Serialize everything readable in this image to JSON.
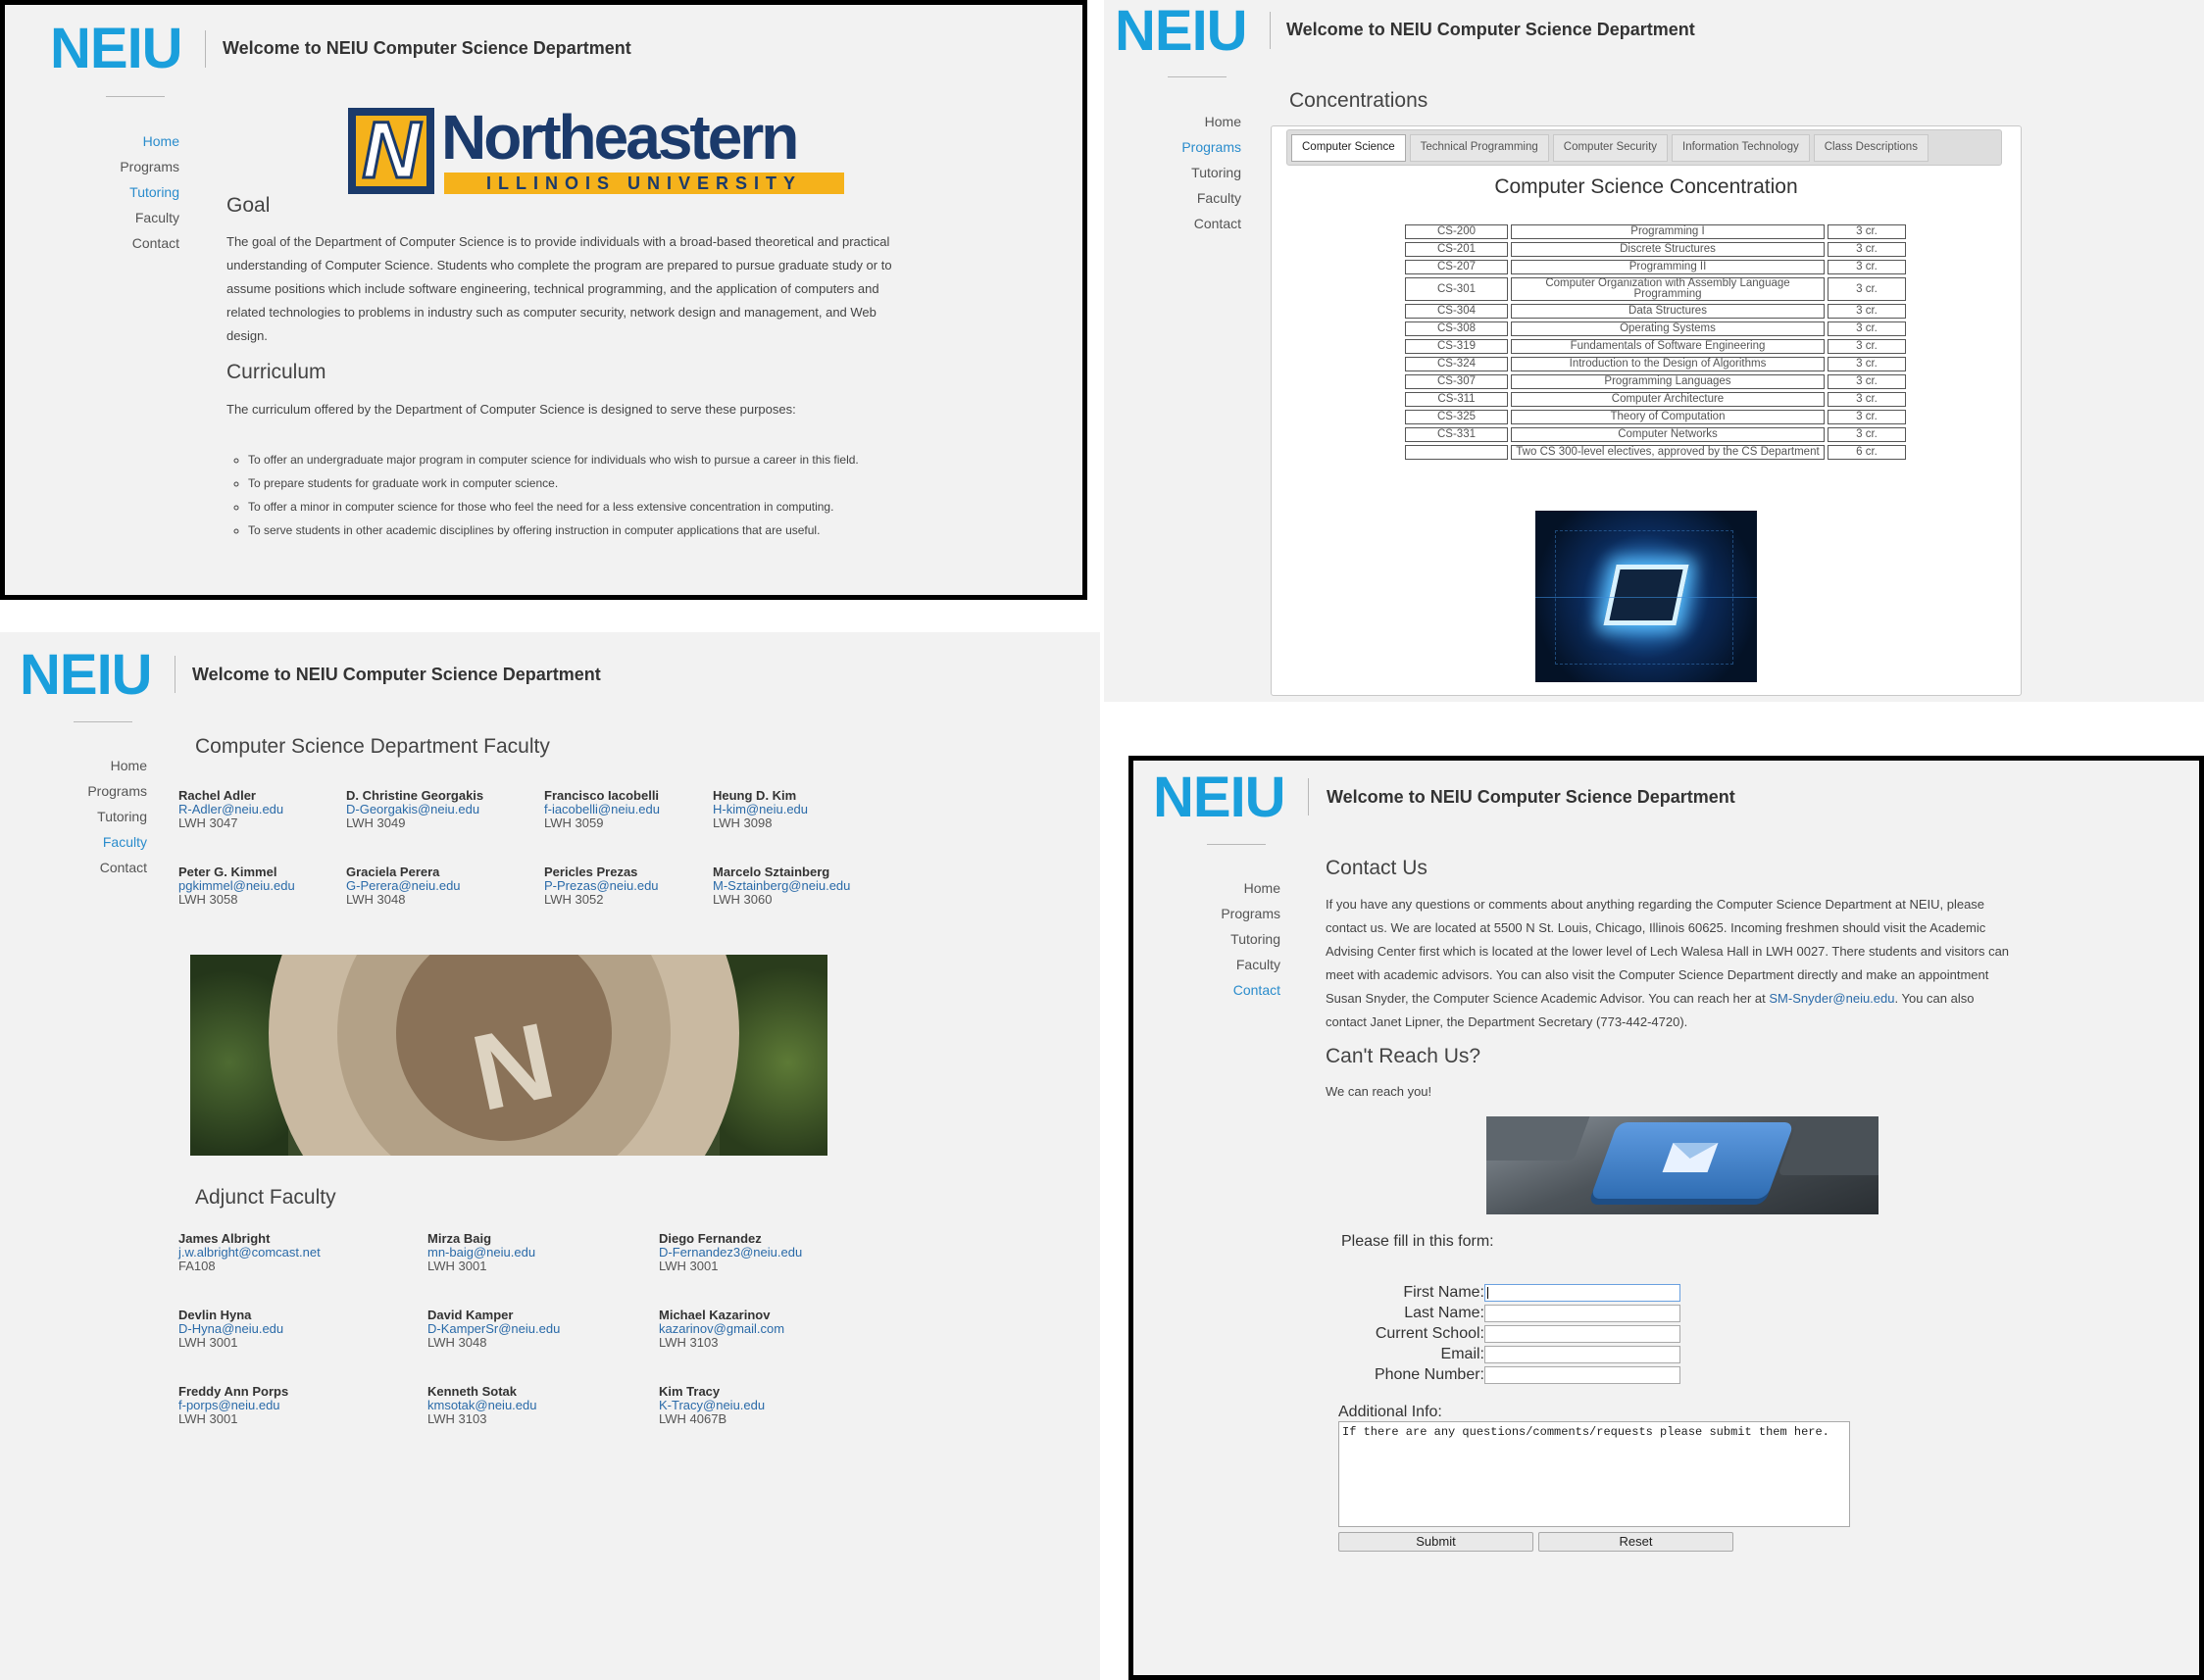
{
  "site": {
    "logo_text": "NEIU",
    "welcome": "Welcome to NEIU Computer Science Department",
    "nav": [
      "Home",
      "Programs",
      "Tutoring",
      "Faculty",
      "Contact"
    ]
  },
  "home": {
    "banner": {
      "word": "Northeastern",
      "sub": "ILLINOIS UNIVERSITY",
      "mark": "N"
    },
    "goal_title": "Goal",
    "goal_text": "The goal of the Department of Computer Science is to provide individuals with a broad-based theoretical and practical understanding of Computer Science. Students who complete the program are prepared to pursue graduate study or to assume positions which include software engineering, technical programming, and the application of computers and related technologies to problems in industry such as computer security, network design and management, and Web design.",
    "curriculum_title": "Curriculum",
    "curriculum_text": "The curriculum offered by the Department of Computer Science is designed to serve these purposes:",
    "purposes": [
      "To offer an undergraduate major program in computer science for individuals who wish to pursue a career in this field.",
      "To prepare students for graduate work in computer science.",
      "To offer a minor in computer science for those who feel the need for a less extensive concentration in computing.",
      "To serve students in other academic disciplines by offering instruction in computer applications that are useful."
    ]
  },
  "programs": {
    "title": "Concentrations",
    "tabs": [
      "Computer Science",
      "Technical Programming",
      "Computer Security",
      "Information Technology",
      "Class Descriptions"
    ],
    "active_tab": 0,
    "concentration_title": "Computer Science Concentration",
    "courses": [
      [
        "CS-200",
        "Programming I",
        "3 cr."
      ],
      [
        "CS-201",
        "Discrete Structures",
        "3 cr."
      ],
      [
        "CS-207",
        "Programming II",
        "3 cr."
      ],
      [
        "CS-301",
        "Computer Organization with Assembly Language Programming",
        "3 cr."
      ],
      [
        "CS-304",
        "Data Structures",
        "3 cr."
      ],
      [
        "CS-308",
        "Operating Systems",
        "3 cr."
      ],
      [
        "CS-319",
        "Fundamentals of Software Engineering",
        "3 cr."
      ],
      [
        "CS-324",
        "Introduction to the Design of Algorithms",
        "3 cr."
      ],
      [
        "CS-307",
        "Programming Languages",
        "3 cr."
      ],
      [
        "CS-311",
        "Computer Architecture",
        "3 cr."
      ],
      [
        "CS-325",
        "Theory of Computation",
        "3 cr."
      ],
      [
        "CS-331",
        "Computer Networks",
        "3 cr."
      ],
      [
        "",
        "Two CS 300-level electives, approved by the CS Department",
        "6 cr."
      ]
    ]
  },
  "faculty": {
    "title": "Computer Science Department Faculty",
    "members": [
      {
        "name": "Rachel Adler",
        "email": "R-Adler@neiu.edu",
        "office": "LWH 3047"
      },
      {
        "name": "D. Christine Georgakis",
        "email": "D-Georgakis@neiu.edu",
        "office": "LWH 3049"
      },
      {
        "name": "Francisco Iacobelli",
        "email": "f-iacobelli@neiu.edu",
        "office": "LWH 3059"
      },
      {
        "name": "Heung D. Kim",
        "email": "H-kim@neiu.edu",
        "office": "LWH 3098"
      },
      {
        "name": "Peter G. Kimmel",
        "email": "pgkimmel@neiu.edu",
        "office": "LWH 3058"
      },
      {
        "name": "Graciela Perera",
        "email": "G-Perera@neiu.edu",
        "office": "LWH 3048"
      },
      {
        "name": "Pericles Prezas",
        "email": "P-Prezas@neiu.edu",
        "office": "LWH 3052"
      },
      {
        "name": "Marcelo Sztainberg",
        "email": "M-Sztainberg@neiu.edu",
        "office": "LWH 3060"
      }
    ],
    "adjunct_title": "Adjunct Faculty",
    "adjunct": [
      {
        "name": "James Albright",
        "email": "j.w.albright@comcast.net",
        "office": "FA108"
      },
      {
        "name": "Mirza Baig",
        "email": "mn-baig@neiu.edu",
        "office": "LWH 3001"
      },
      {
        "name": "Diego Fernandez",
        "email": "D-Fernandez3@neiu.edu",
        "office": "LWH 3001"
      },
      {
        "name": "Devlin Hyna",
        "email": "D-Hyna@neiu.edu",
        "office": "LWH 3001"
      },
      {
        "name": "David Kamper",
        "email": "D-KamperSr@neiu.edu",
        "office": "LWH 3048"
      },
      {
        "name": "Michael Kazarinov",
        "email": "kazarinov@gmail.com",
        "office": "LWH 3103"
      },
      {
        "name": "Freddy Ann Porps",
        "email": "f-porps@neiu.edu",
        "office": "LWH 3001"
      },
      {
        "name": "Kenneth Sotak",
        "email": "kmsotak@neiu.edu",
        "office": "LWH 3103"
      },
      {
        "name": "Kim Tracy",
        "email": "K-Tracy@neiu.edu",
        "office": "LWH 4067B"
      }
    ]
  },
  "contact": {
    "title": "Contact Us",
    "text_before": "If you have any questions or comments about anything regarding the Computer Science Department at NEIU, please contact us. We are located at 5500 N St. Louis, Chicago, Illinois 60625. Incoming freshmen should visit the Academic Advising Center first which is located at the lower level of Lech Walesa Hall in LWH 0027. There students and visitors can meet with academic advisors. You can also visit the Computer Science Department directly and make an appointment Susan Snyder, the Computer Science Academic Advisor. You can reach her at ",
    "email_link": "SM-Snyder@neiu.edu",
    "text_after": ". You can also contact Janet Lipner, the Department Secretary (773-442-4720).",
    "reach_title": "Can't Reach Us?",
    "reach_text": "We can reach you!",
    "form_intro": "Please fill in this form:",
    "fields": [
      "First Name:",
      "Last Name:",
      "Current School:",
      "Email:",
      "Phone Number:"
    ],
    "additional_label": "Additional Info:",
    "additional_placeholder": "If there are any questions/comments/requests please submit them here.",
    "submit": "Submit",
    "reset": "Reset"
  },
  "colors": {
    "brand_blue": "#1a9fdc",
    "active_link": "#2a8ccc",
    "gold": "#f5b21b",
    "navy": "#1b3a6b"
  }
}
